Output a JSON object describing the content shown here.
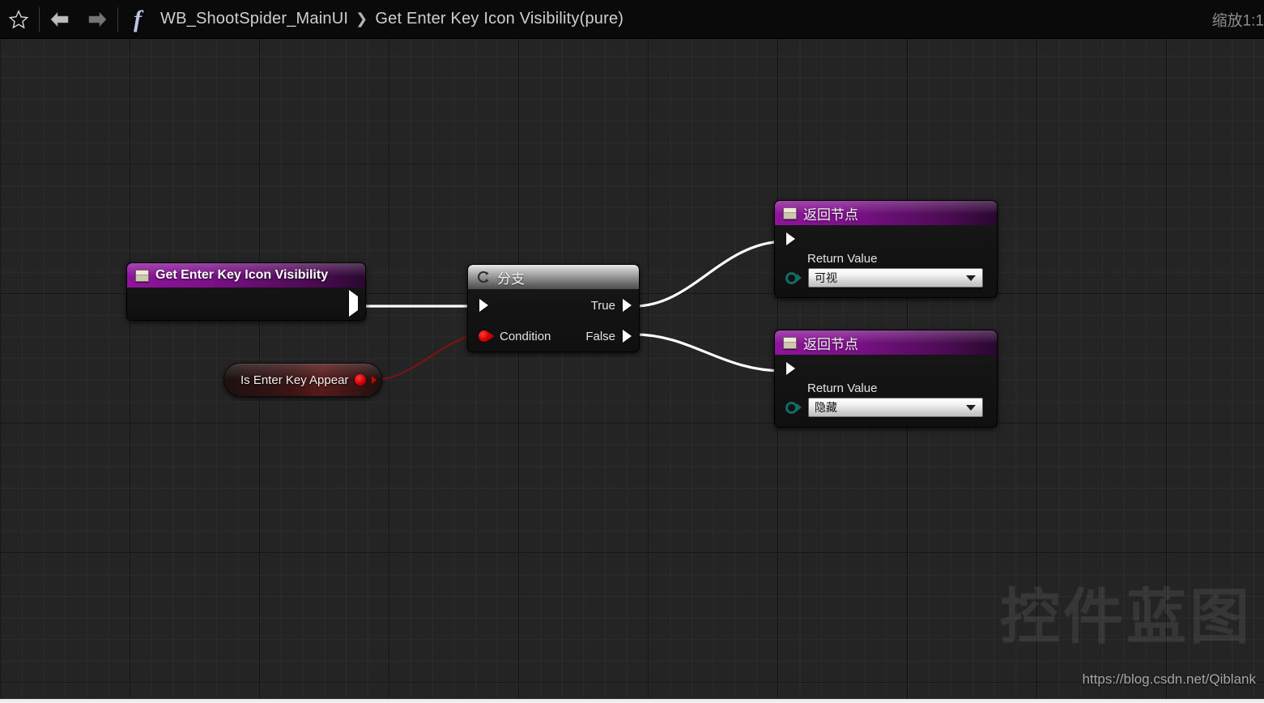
{
  "toolbar": {
    "favorite_icon": "star-icon",
    "back_icon": "arrow-left-icon",
    "forward_icon": "arrow-right-icon",
    "function_icon": "function-fx-icon",
    "breadcrumb_root": "WB_ShootSpider_MainUI",
    "breadcrumb_sep": "❯",
    "breadcrumb_current": "Get Enter Key Icon Visibility(pure)",
    "zoom_label": "缩放1:1"
  },
  "graph": {
    "entry_node": {
      "title": "Get Enter Key Icon Visibility",
      "icon": "function-entry-icon",
      "exec_out_pin": "exec-out"
    },
    "branch_node": {
      "title": "分支",
      "icon": "branch-icon",
      "exec_in_pin": "exec-in",
      "condition_label": "Condition",
      "true_label": "True",
      "false_label": "False"
    },
    "variable_node": {
      "label": "Is Enter Key Appear",
      "output_pin": "bool-out"
    },
    "return_nodes": [
      {
        "title": "返回节点",
        "icon": "function-result-icon",
        "value_label": "Return Value",
        "combo_value": "可视"
      },
      {
        "title": "返回节点",
        "icon": "function-result-icon",
        "value_label": "Return Value",
        "combo_value": "隐藏"
      }
    ]
  },
  "watermark": {
    "text": "控件蓝图",
    "url": "https://blog.csdn.net/Qiblank"
  },
  "colors": {
    "node_header_purple": "#8e149b",
    "exec_wire": "#ffffff",
    "bool_wire": "#8b0f0f",
    "enum_pin": "#0f6b63",
    "canvas_bg": "#242424"
  }
}
